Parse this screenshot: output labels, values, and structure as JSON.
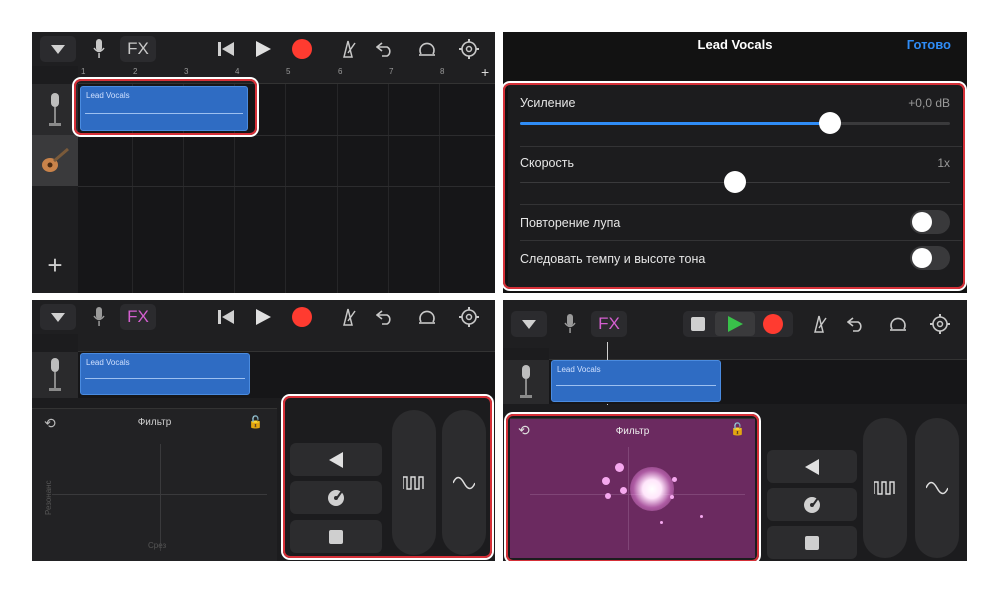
{
  "panel1": {
    "toolbar": {
      "fx_label": "FX"
    },
    "ruler_numbers": [
      "1",
      "2",
      "3",
      "4",
      "5",
      "6",
      "7",
      "8"
    ],
    "add_label": "+",
    "track_add_label": "+",
    "region_label": "Lead Vocals"
  },
  "panel2": {
    "title": "Lead Vocals",
    "done": "Готово",
    "gain": {
      "label": "Усиление",
      "value": "+0,0 dB",
      "level": 0.72
    },
    "speed": {
      "label": "Скорость",
      "value": "1x",
      "level": 0.5
    },
    "loop": {
      "label": "Повторение лупа",
      "on": false
    },
    "follow": {
      "label": "Следовать темпу и высоте тона",
      "on": false
    }
  },
  "panel3": {
    "toolbar": {
      "fx_label": "FX"
    },
    "region_label": "Lead Vocals",
    "filter_title": "Фильтр",
    "axis_x": "Срез",
    "axis_y": "Резонанс"
  },
  "panel4": {
    "toolbar": {
      "fx_label": "FX"
    },
    "region_label": "Lead Vocals",
    "filter_title": "Фильтр"
  },
  "colors": {
    "accent": "#2f8cf6",
    "record": "#ff3b30",
    "region": "#2f6cc3",
    "highlight": "#d63038",
    "fx_active": "#d45fd0",
    "pad_active": "#6b2a60"
  }
}
